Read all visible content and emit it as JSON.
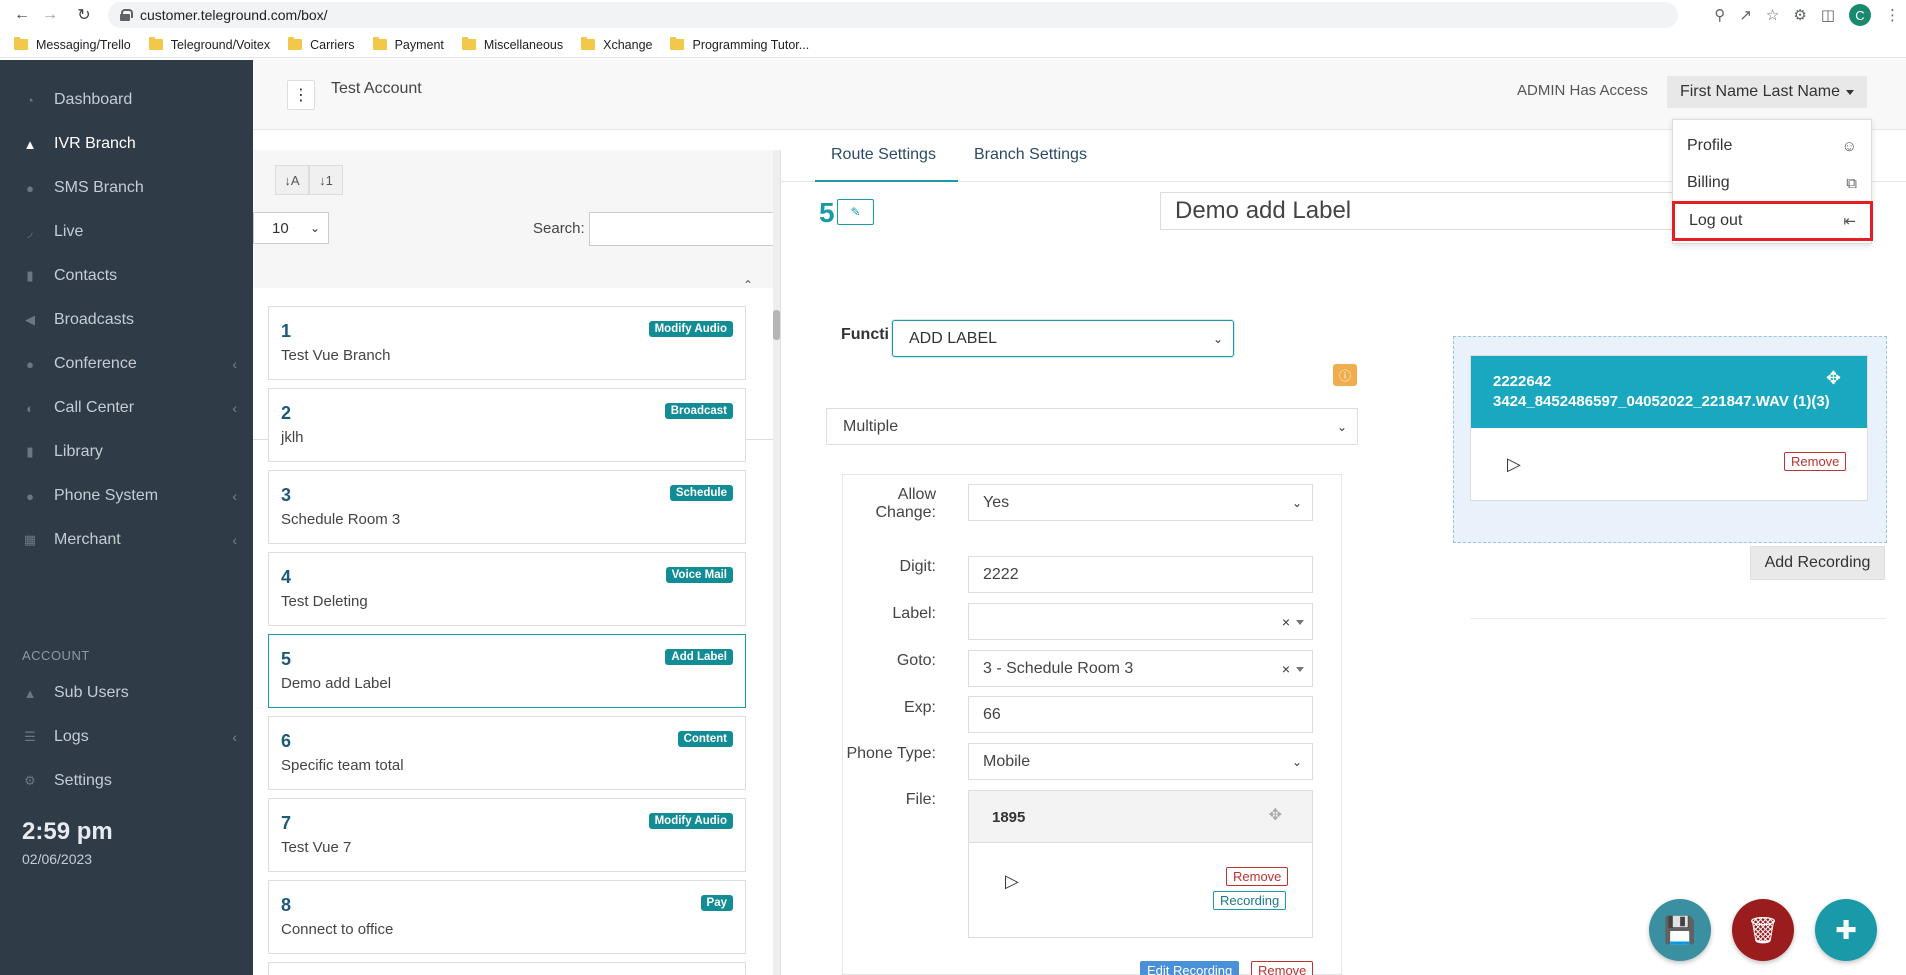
{
  "browser": {
    "url": "customer.teleground.com/box/",
    "avatar_letter": "C",
    "bookmarks": [
      "Messaging/Trello",
      "Teleground/Voitex",
      "Carriers",
      "Payment",
      "Miscellaneous",
      "Xchange",
      "Programming Tutor..."
    ]
  },
  "sidebar": {
    "items": [
      {
        "label": "Dashboard",
        "icon": "dashboard-icon",
        "chevron": false
      },
      {
        "label": "IVR Branch",
        "icon": "sitemap-icon",
        "chevron": false,
        "active": true
      },
      {
        "label": "SMS Branch",
        "icon": "chat-icon",
        "chevron": false
      },
      {
        "label": "Live",
        "icon": "rss-icon",
        "chevron": false
      },
      {
        "label": "Contacts",
        "icon": "book-icon",
        "chevron": false
      },
      {
        "label": "Broadcasts",
        "icon": "megaphone-icon",
        "chevron": false
      },
      {
        "label": "Conference",
        "icon": "microphone-icon",
        "chevron": true
      },
      {
        "label": "Call Center",
        "icon": "headset-icon",
        "chevron": true
      },
      {
        "label": "Library",
        "icon": "library-icon",
        "chevron": false
      },
      {
        "label": "Phone System",
        "icon": "phone-system-icon",
        "chevron": true
      },
      {
        "label": "Merchant",
        "icon": "merchant-icon",
        "chevron": true
      }
    ],
    "account_section": "ACCOUNT",
    "account_items": [
      {
        "label": "Sub Users",
        "icon": "users-icon",
        "chevron": false
      },
      {
        "label": "Logs",
        "icon": "logs-icon",
        "chevron": true
      },
      {
        "label": "Settings",
        "icon": "gear-icon",
        "chevron": false
      }
    ],
    "time": "2:59 pm",
    "date": "02/06/2023"
  },
  "header": {
    "account_title": "Test Account",
    "admin_access": "ADMIN Has Access",
    "user_name": "First Name Last Name"
  },
  "user_menu": {
    "items": [
      {
        "label": "Profile",
        "icon": "user-icon"
      },
      {
        "label": "Billing",
        "icon": "billing-icon"
      },
      {
        "label": "Log out",
        "icon": "logout-icon",
        "highlighted": true
      }
    ]
  },
  "list": {
    "per_page": "10",
    "search_label": "Search:",
    "items": [
      {
        "num": "1",
        "name": "Test Vue Branch",
        "badge": "Modify Audio"
      },
      {
        "num": "2",
        "name": "jklh",
        "badge": "Broadcast"
      },
      {
        "num": "3",
        "name": "Schedule Room 3",
        "badge": "Schedule"
      },
      {
        "num": "4",
        "name": "Test Deleting",
        "badge": "Voice Mail"
      },
      {
        "num": "5",
        "name": "Demo add Label",
        "badge": "Add Label",
        "selected": true
      },
      {
        "num": "6",
        "name": "Specific team total",
        "badge": "Content"
      },
      {
        "num": "7",
        "name": "Test Vue 7",
        "badge": "Modify Audio"
      },
      {
        "num": "8",
        "name": "Connect to office",
        "badge": "Pay"
      }
    ]
  },
  "main": {
    "tabs": [
      {
        "label": "Route Settings",
        "active": true
      },
      {
        "label": "Branch Settings"
      }
    ],
    "route_number": "5",
    "route_label": "Demo add Label",
    "function_label": "Functi",
    "function_value": "ADD LABEL",
    "mode_value": "Multiple",
    "form": {
      "allow_change_label_1": "Allow",
      "allow_change_label_2": "Change:",
      "allow_change_value": "Yes",
      "digit_label": "Digit:",
      "digit_value": "2222",
      "label_label": "Label:",
      "label_value": "",
      "goto_label": "Goto:",
      "goto_value": "3 - Schedule Room 3",
      "exp_label": "Exp:",
      "exp_value": "66",
      "phone_type_label": "Phone Type:",
      "phone_type_value": "Mobile",
      "file_label": "File:",
      "file_name": "1895",
      "remove_label": "Remove",
      "recording_label": "Recording",
      "edit_recording_label": "Edit Recording",
      "remove2_label": "Remove"
    },
    "recording_panel": {
      "title_line1": "2222642",
      "title_line2": "3424_8452486597_04052022_221847.WAV (1)(3)",
      "remove_label": "Remove",
      "add_recording_label": "Add Recording"
    }
  },
  "fabs": {
    "save_color": "#3a8fa0",
    "delete_color": "#9b1c1c",
    "add_color": "#1a9aa8"
  },
  "colors": {
    "sidebar_bg": "#2f3b47",
    "accent_teal": "#1a9aa8",
    "badge_teal": "#128c95",
    "highlight_red": "#e31e24"
  }
}
